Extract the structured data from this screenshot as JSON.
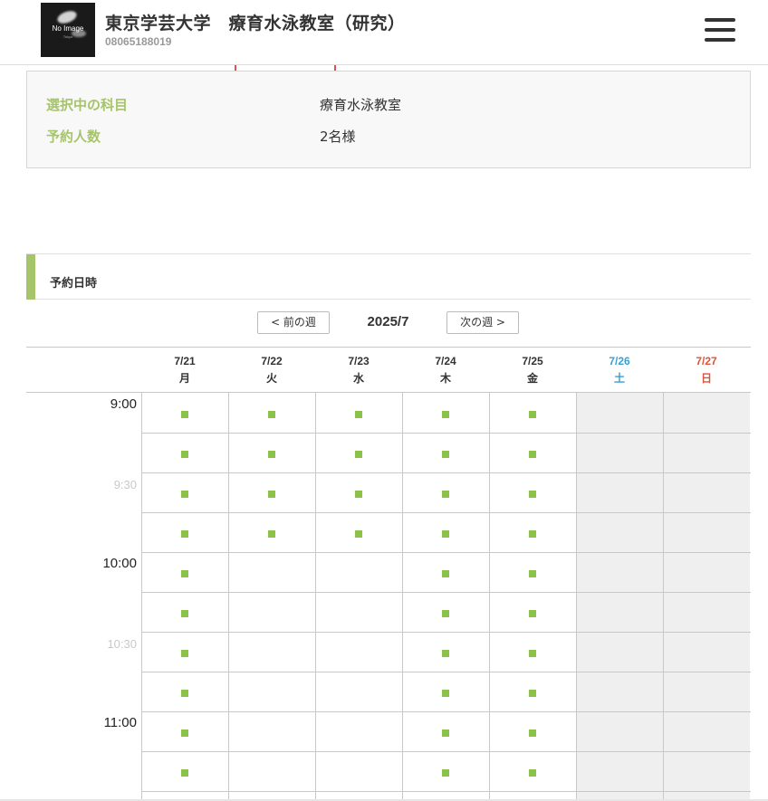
{
  "header": {
    "logo_text": "No Image",
    "logo_subtext": "Tokyo",
    "shop_name": "東京学芸大学　療育水泳教室（研究）",
    "phone": "08065188019"
  },
  "summary": {
    "subject_label": "選択中の科目",
    "subject_value": "療育水泳教室",
    "people_label": "予約人数",
    "people_value": "2名様"
  },
  "section_title": "予約日時",
  "week_nav": {
    "prev_label": "< 前の週",
    "month_label": "2025/7",
    "next_label": "次の週 >"
  },
  "days": [
    {
      "date": "7/21",
      "weekday": "月"
    },
    {
      "date": "7/22",
      "weekday": "火"
    },
    {
      "date": "7/23",
      "weekday": "水"
    },
    {
      "date": "7/24",
      "weekday": "木"
    },
    {
      "date": "7/25",
      "weekday": "金"
    },
    {
      "date": "7/26",
      "weekday": "土"
    },
    {
      "date": "7/27",
      "weekday": "日"
    }
  ],
  "times": [
    "9:00",
    "9:30",
    "10:00",
    "10:30",
    "11:00"
  ],
  "availability": [
    [
      1,
      1,
      1,
      1,
      1,
      0,
      0
    ],
    [
      1,
      1,
      1,
      1,
      1,
      0,
      0
    ],
    [
      1,
      1,
      1,
      1,
      1,
      0,
      0
    ],
    [
      1,
      1,
      1,
      1,
      1,
      0,
      0
    ],
    [
      1,
      0,
      0,
      1,
      1,
      0,
      0
    ],
    [
      1,
      0,
      0,
      1,
      1,
      0,
      0
    ],
    [
      1,
      0,
      0,
      1,
      1,
      0,
      0
    ],
    [
      1,
      0,
      0,
      1,
      1,
      0,
      0
    ],
    [
      1,
      0,
      0,
      1,
      1,
      0,
      0
    ],
    [
      1,
      0,
      0,
      1,
      1,
      0,
      0
    ]
  ],
  "colors": {
    "accent_green": "#a6c46a",
    "slot_green": "#8bc34a",
    "saturday_blue": "#3aa0d0",
    "sunday_red": "#e0533a"
  }
}
